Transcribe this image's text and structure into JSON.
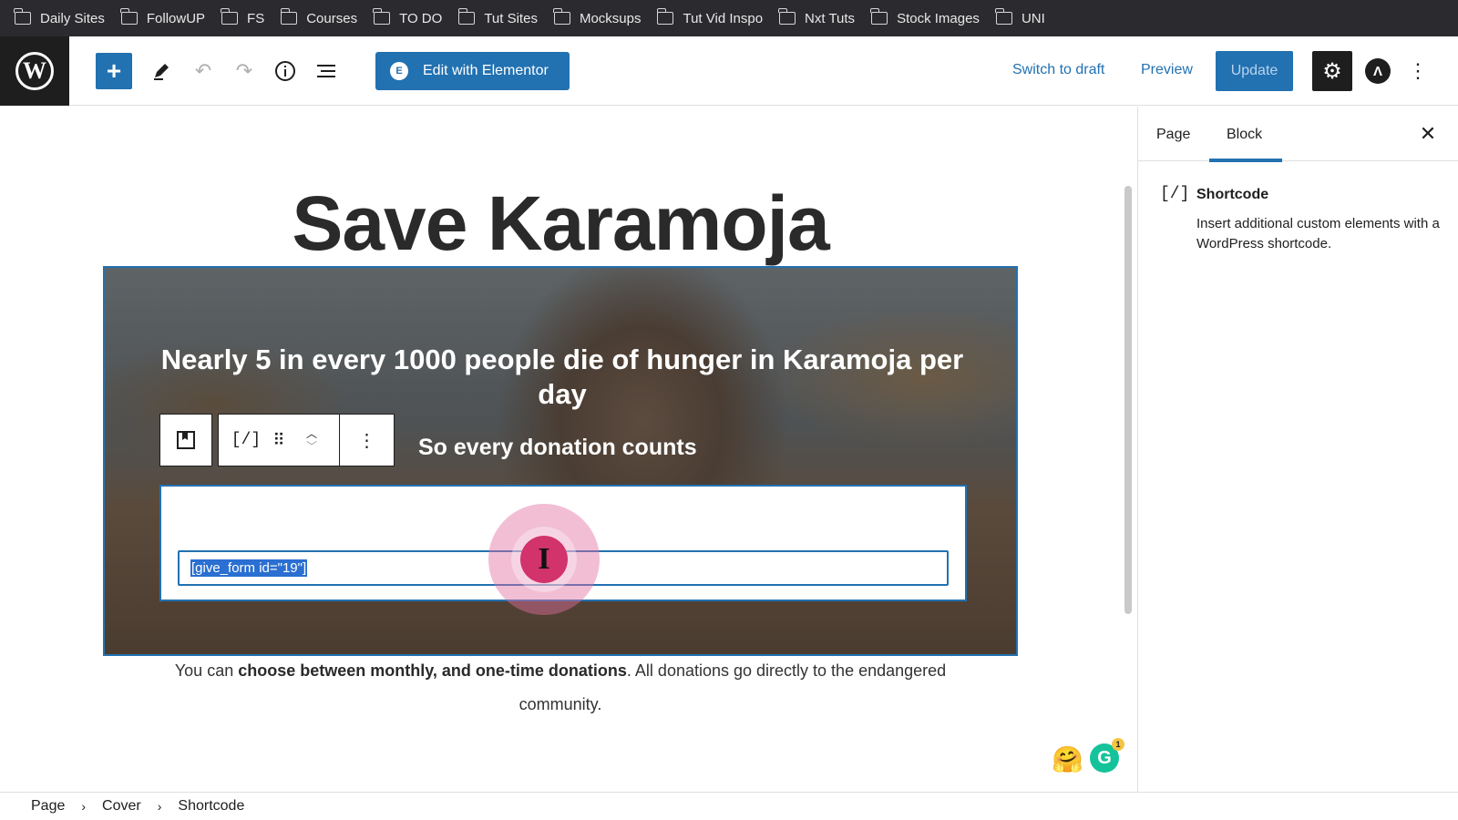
{
  "bookmarks": [
    {
      "label": "Daily Sites"
    },
    {
      "label": "FollowUP"
    },
    {
      "label": "FS"
    },
    {
      "label": "Courses"
    },
    {
      "label": "TO DO"
    },
    {
      "label": "Tut Sites"
    },
    {
      "label": "Mocksups"
    },
    {
      "label": "Tut Vid Inspo"
    },
    {
      "label": "Nxt Tuts"
    },
    {
      "label": "Stock Images"
    },
    {
      "label": "UNI"
    }
  ],
  "header": {
    "elementor_label": "Edit with Elementor",
    "switch_to_draft": "Switch to draft",
    "preview": "Preview",
    "update": "Update"
  },
  "content": {
    "page_title": "Save Karamoja",
    "cover_heading": "Nearly 5 in every 1000 people die of hunger in Karamoja per day",
    "cover_subheading": "So every donation counts",
    "shortcode_value": "[give_form id=\"19\"]",
    "paragraph_plain_1": "You can ",
    "paragraph_bold": "choose between monthly, and one-time donations",
    "paragraph_plain_2": ". All donations go directly to the endangered community."
  },
  "grammarly_count": "1",
  "sidebar": {
    "tabs": [
      {
        "label": "Page"
      },
      {
        "label": "Block"
      }
    ],
    "active_tab": "Block",
    "block_icon": "[/]",
    "block_title": "Shortcode",
    "block_description": "Insert additional custom elements with a WordPress shortcode."
  },
  "breadcrumb": [
    {
      "label": "Page"
    },
    {
      "label": "Cover"
    },
    {
      "label": "Shortcode"
    }
  ],
  "colors": {
    "accent": "#2271b1",
    "dark": "#1e1e1e",
    "bookmark_bar": "#2b2b2f"
  }
}
